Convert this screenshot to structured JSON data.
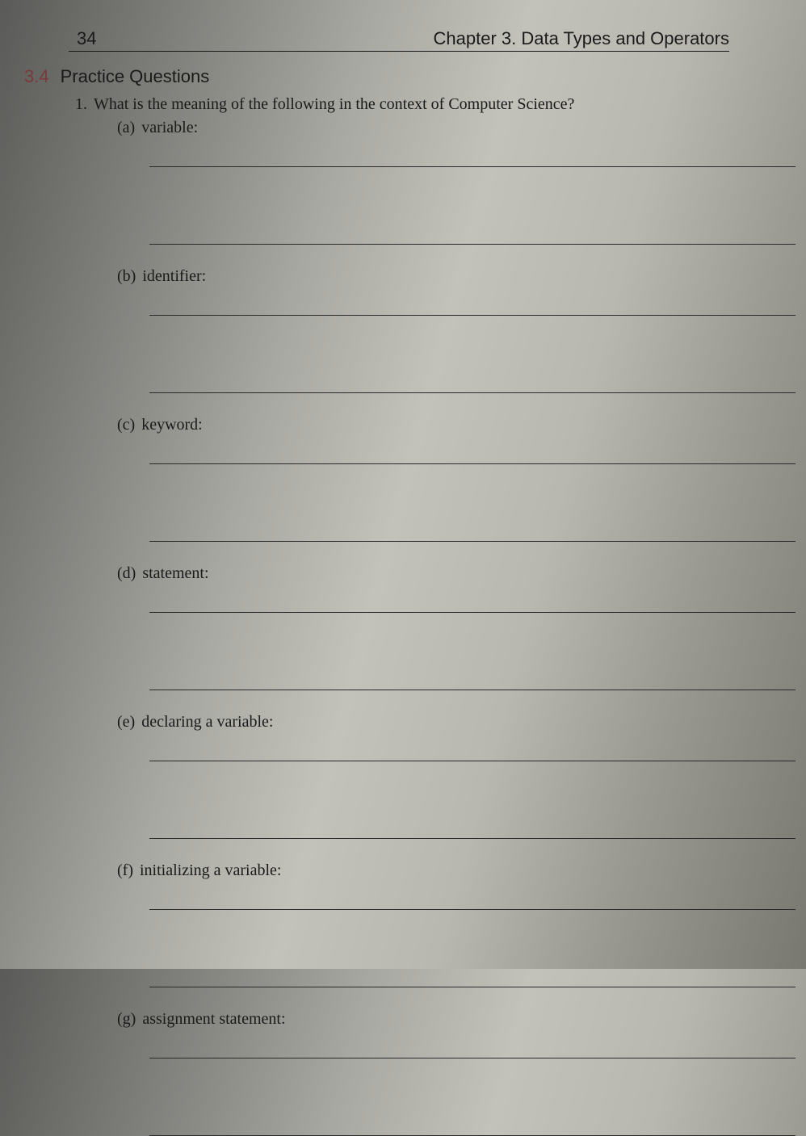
{
  "page_number": "34",
  "chapter_title": "Chapter 3. Data Types and Operators",
  "section": {
    "number": "3.4",
    "title": "Practice Questions"
  },
  "question": {
    "number": "1.",
    "text": "What is the meaning of the following in the context of Computer Science?",
    "subquestions": [
      {
        "label": "(a)",
        "text": "variable:"
      },
      {
        "label": "(b)",
        "text": "identifier:"
      },
      {
        "label": "(c)",
        "text": "keyword:"
      },
      {
        "label": "(d)",
        "text": "statement:"
      },
      {
        "label": "(e)",
        "text": "declaring a variable:"
      },
      {
        "label": "(f)",
        "text": "initializing a variable:"
      },
      {
        "label": "(g)",
        "text": "assignment statement:"
      }
    ]
  }
}
